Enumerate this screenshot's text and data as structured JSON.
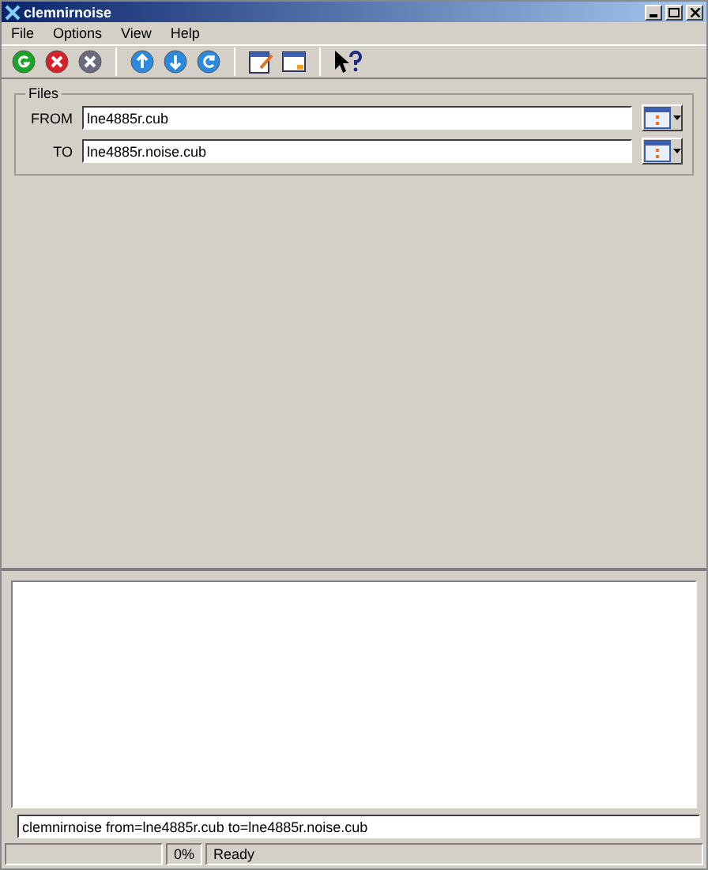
{
  "window": {
    "title": "clemnirnoise"
  },
  "menu": [
    "File",
    "Options",
    "View",
    "Help"
  ],
  "files": {
    "title": "Files",
    "rows": [
      {
        "label": "FROM",
        "value": "lne4885r.cub"
      },
      {
        "label": "TO",
        "value": "lne4885r.noise.cub"
      }
    ]
  },
  "command_line": {
    "value": "clemnirnoise from=lne4885r.cub to=lne4885r.noise.cub"
  },
  "status_bar": {
    "progress": {
      "level": 0,
      "reading": "0%"
    },
    "message": "Ready"
  }
}
